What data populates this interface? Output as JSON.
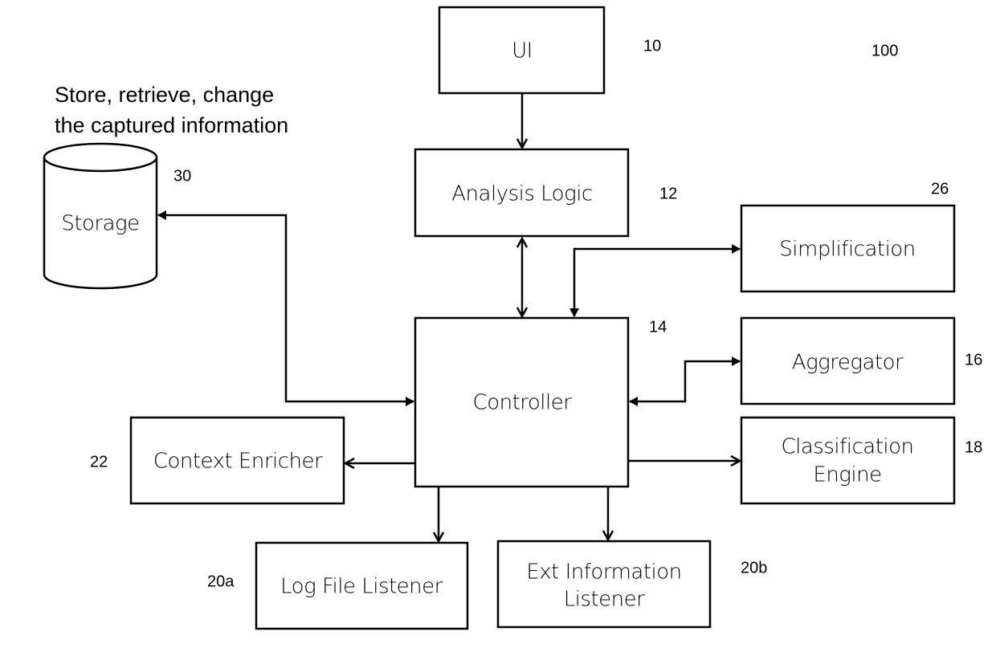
{
  "diagram": {
    "figure_ref": "100",
    "note": {
      "line1": "Store, retrieve, change",
      "line2": "the captured information"
    },
    "components": {
      "ui": {
        "label": "UI",
        "ref": "10"
      },
      "analysis_logic": {
        "label": "Analysis Logic",
        "ref": "12"
      },
      "controller": {
        "label": "Controller",
        "ref": "14"
      },
      "aggregator": {
        "label": "Aggregator",
        "ref": "16"
      },
      "classification_engine": {
        "label_line1": "Classification",
        "label_line2": "Engine",
        "ref": "18"
      },
      "log_file_listener": {
        "label": "Log File Listener",
        "ref": "20a"
      },
      "ext_information_listener": {
        "label_line1": "Ext Information",
        "label_line2": "Listener",
        "ref": "20b"
      },
      "context_enricher": {
        "label": "Context Enricher",
        "ref": "22"
      },
      "simplification": {
        "label": "Simplification",
        "ref": "26"
      },
      "storage": {
        "label": "Storage",
        "ref": "30"
      }
    },
    "connections": [
      {
        "from": "UI",
        "to": "Analysis Logic",
        "direction": "one-way"
      },
      {
        "from": "Analysis Logic",
        "to": "Controller",
        "direction": "two-way"
      },
      {
        "from": "Controller",
        "to": "Simplification",
        "direction": "two-way"
      },
      {
        "from": "Controller",
        "to": "Aggregator",
        "direction": "two-way"
      },
      {
        "from": "Controller",
        "to": "Classification Engine",
        "direction": "one-way"
      },
      {
        "from": "Controller",
        "to": "Context Enricher",
        "direction": "one-way"
      },
      {
        "from": "Controller",
        "to": "Log File Listener",
        "direction": "one-way"
      },
      {
        "from": "Controller",
        "to": "Ext Information Listener",
        "direction": "one-way"
      },
      {
        "from": "Controller",
        "to": "Storage",
        "direction": "two-way"
      }
    ]
  }
}
